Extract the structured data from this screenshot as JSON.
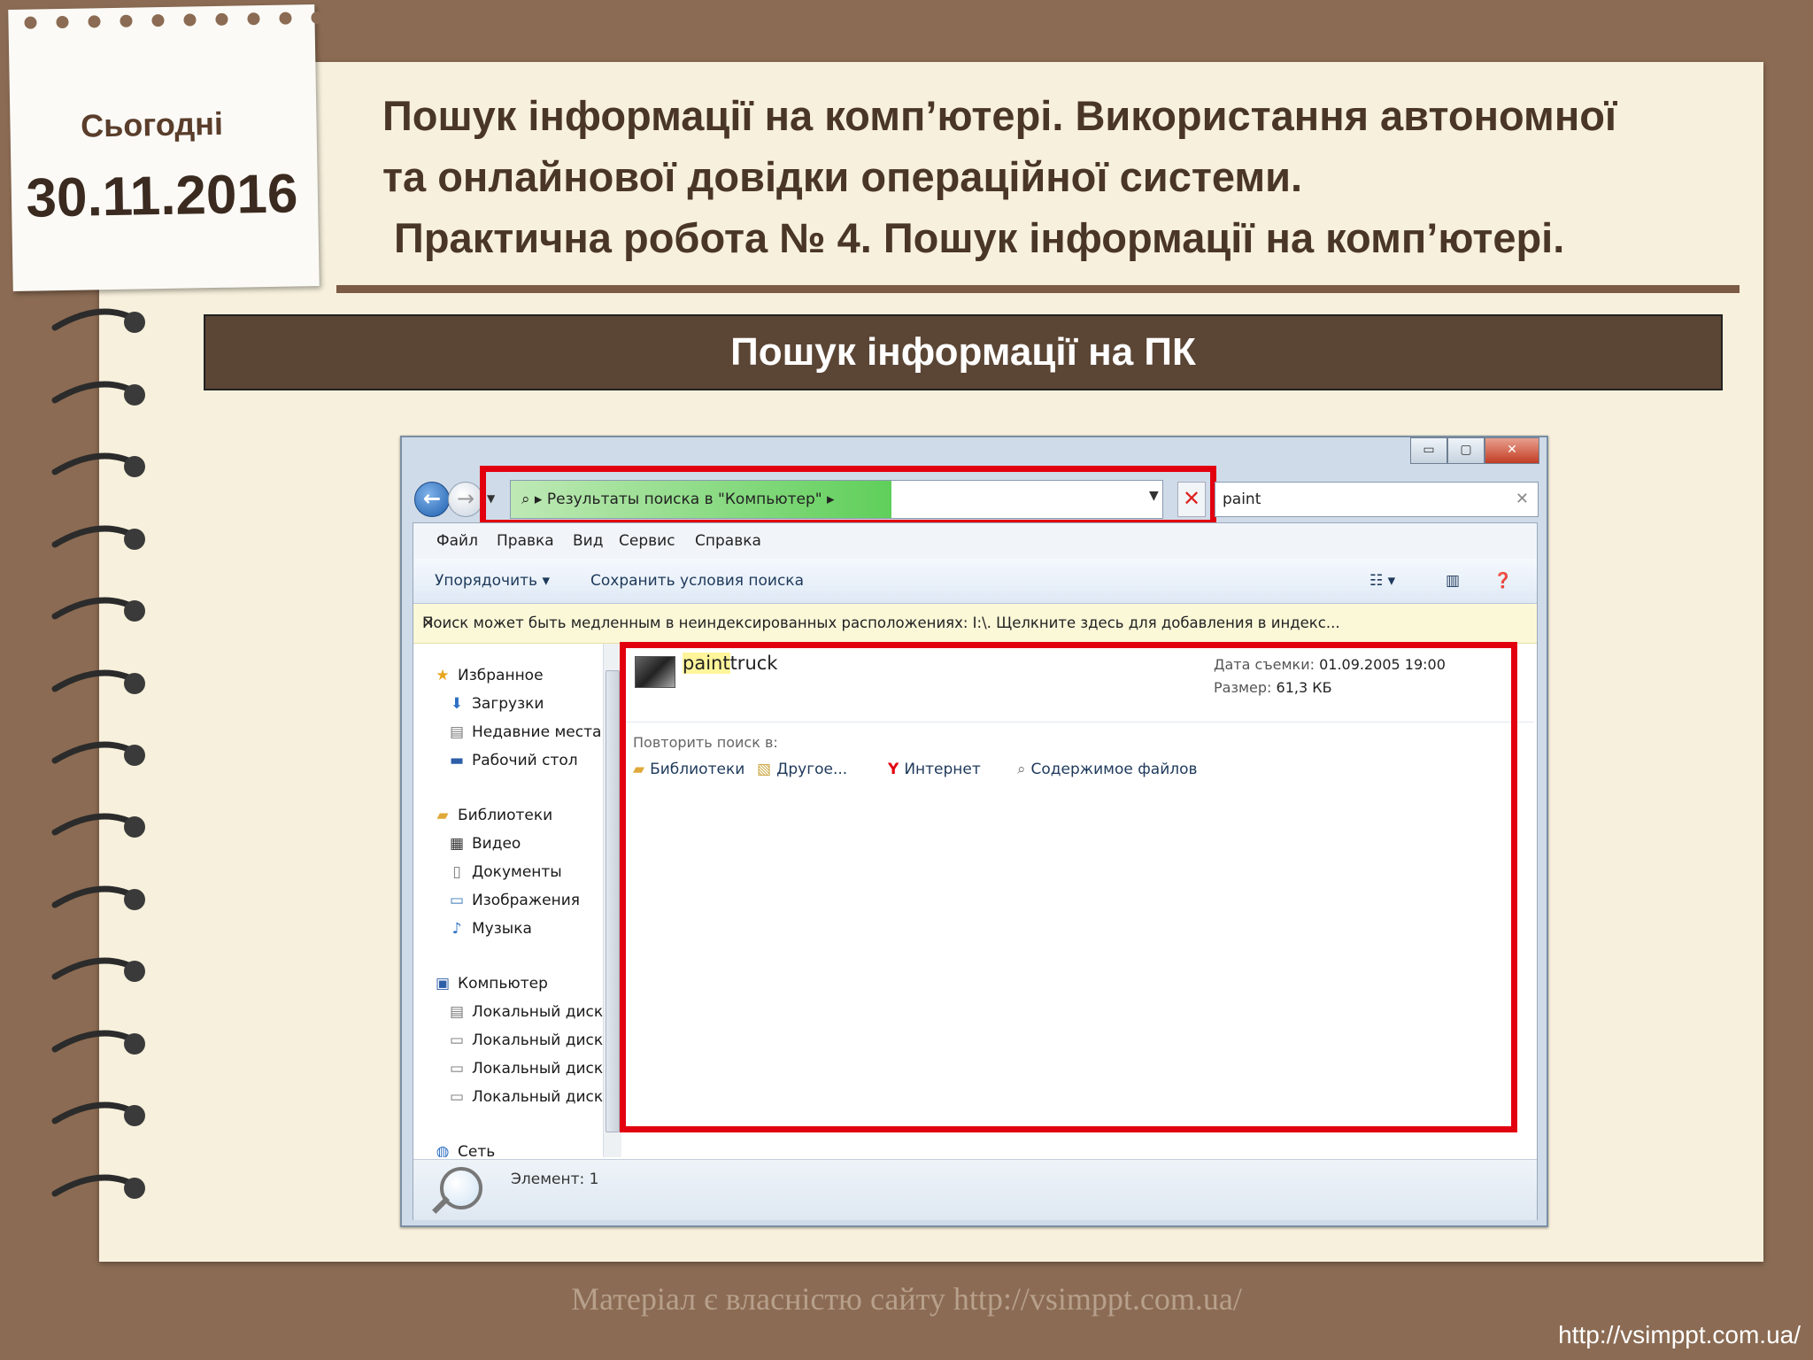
{
  "slide": {
    "today_label": "Сьогодні",
    "date": "30.11.2016",
    "title_lines": [
      "Пошук інформації на комп’ютері. Використання автономної",
      "та онлайнової довідки операційної системи.",
      " Практична робота № 4. Пошук інформації на комп’ютері."
    ],
    "banner": "Пошук інформації на ПК",
    "watermark": "Матеріал є власністю сайту http://vsimppt.com.ua/",
    "url": "http://vsimppt.com.ua/"
  },
  "explorer": {
    "caption_buttons": {
      "minimize": "▭",
      "maximize": "▢",
      "close": "✕"
    },
    "address": {
      "text": "Результаты поиска в \"Компьютер\""
    },
    "search": {
      "value": "paint"
    },
    "menu": [
      "Файл",
      "Правка",
      "Вид",
      "Сервис",
      "Справка"
    ],
    "toolbar": {
      "organize": "Упорядочить",
      "save_search": "Сохранить условия поиска"
    },
    "infobar": "Поиск может быть медленным в неиндексированных расположениях: I:\\. Щелкните здесь для добавления в индекс...",
    "nav": {
      "favorites": "Избранное",
      "downloads": "Загрузки",
      "recent": "Недавние места",
      "desktop": "Рабочий стол",
      "libraries": "Библиотеки",
      "video": "Видео",
      "documents": "Документы",
      "images": "Изображения",
      "music": "Музыка",
      "computer": "Компьютер",
      "disks": [
        "Локальный диск",
        "Локальный диск",
        "Локальный диск",
        "Локальный диск"
      ],
      "network": "Сеть"
    },
    "result": {
      "name_match": "paint",
      "name_rest": "truck",
      "date_label": "Дата съемки:",
      "date_value": "01.09.2005 19:00",
      "size_label": "Размер:",
      "size_value": "61,3 КБ"
    },
    "repeat_label": "Повторить поиск в:",
    "repeat_options": [
      "Библиотеки",
      "Другое...",
      "Интернет",
      "Содержимое файлов"
    ],
    "status": "Элемент: 1",
    "colors": {
      "highlight_box": "#e2000f",
      "banner": "#5b4535",
      "paper": "#f7f0dc"
    }
  }
}
